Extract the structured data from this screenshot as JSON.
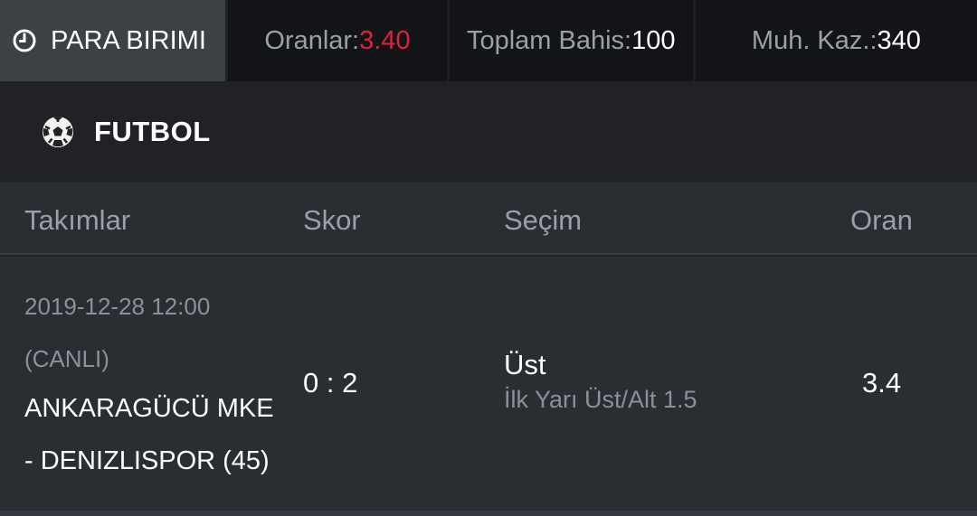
{
  "header": {
    "currency_label": "PARA BIRIMI",
    "odds_label": "Oranlar: ",
    "odds_value": "3.40",
    "stake_label": "Toplam Bahis: ",
    "stake_value": "100",
    "potential_win_label": "Muh. Kaz.: ",
    "potential_win_value": "340",
    "icons": {
      "currency": "clock-icon"
    },
    "colors": {
      "odds_value": "#e0213a",
      "label": "#9aa0a8"
    }
  },
  "section": {
    "title": "FUTBOL",
    "icon": "soccer-ball-icon"
  },
  "table": {
    "columns": [
      "Takımlar",
      "Skor",
      "Seçim",
      "Oran"
    ],
    "rows": [
      {
        "date": "2019-12-28 12:00",
        "status": "(CANLI)",
        "home": "ANKARAGÜCÜ MKE",
        "away": "- DENIZLISPOR (45)",
        "score": "0 : 2",
        "selection": "Üst",
        "market": "İlk Yarı Üst/Alt 1.5",
        "odd": "3.4"
      }
    ]
  }
}
